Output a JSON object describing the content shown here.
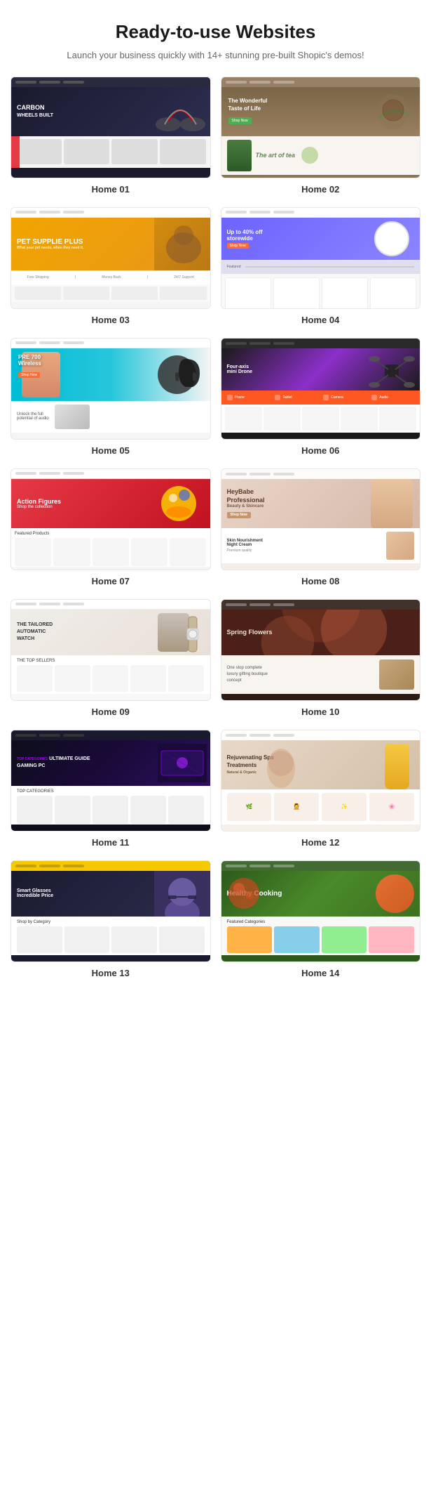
{
  "header": {
    "title": "Ready-to-use Websites",
    "subtitle": "Launch your business quickly with 14+ stunning pre-built Shopic's demos!"
  },
  "demos": [
    {
      "id": 1,
      "label": "Home 01",
      "theme": "thumb-01",
      "hero_text": "CARBON WHEELS BUILT",
      "accent": "#e63946"
    },
    {
      "id": 2,
      "label": "Home 02",
      "theme": "thumb-02",
      "hero_text": "The Wonderful Taste of Life",
      "accent": "#4CAF50"
    },
    {
      "id": 3,
      "label": "Home 03",
      "theme": "thumb-03",
      "hero_text": "PET SUPPLIE PLUS",
      "accent": "#f0a500"
    },
    {
      "id": 4,
      "label": "Home 04",
      "theme": "thumb-04",
      "hero_text": "Up to 40% off storewide",
      "accent": "#6c63ff"
    },
    {
      "id": 5,
      "label": "Home 05",
      "theme": "thumb-05",
      "hero_text": "PRE 700 Wireless",
      "accent": "#00bcd4"
    },
    {
      "id": 6,
      "label": "Home 06",
      "theme": "thumb-06",
      "hero_text": "Four-axis mini Drone",
      "accent": "#8b2fc9"
    },
    {
      "id": 7,
      "label": "Home 07",
      "theme": "thumb-07",
      "hero_text": "Action Figures",
      "accent": "#e63946"
    },
    {
      "id": 8,
      "label": "Home 08",
      "theme": "thumb-08",
      "hero_text": "HeyBabe Professional",
      "accent": "#d4a882"
    },
    {
      "id": 9,
      "label": "Home 09",
      "theme": "thumb-09",
      "hero_text": "THE TAILORED AUTOMATIC WATCH",
      "accent": "#c8c0b8"
    },
    {
      "id": 10,
      "label": "Home 10",
      "theme": "thumb-10",
      "hero_text": "Spring Flowers",
      "accent": "#a85a45"
    },
    {
      "id": 11,
      "label": "Home 11",
      "theme": "thumb-11",
      "hero_text": "ULTIMATE GUIDE GAMING PC",
      "accent": "#a000ff"
    },
    {
      "id": 12,
      "label": "Home 12",
      "theme": "thumb-12",
      "hero_text": "Rejuvenating Spa Treatments",
      "accent": "#f5c842"
    },
    {
      "id": 13,
      "label": "Home 13",
      "theme": "thumb-13",
      "hero_text": "Smart Glasses Incredible Price",
      "accent": "#f5c800"
    },
    {
      "id": 14,
      "label": "Home 14",
      "theme": "thumb-14",
      "hero_text": "Healthy Cooking",
      "accent": "#4a8a2a"
    }
  ]
}
